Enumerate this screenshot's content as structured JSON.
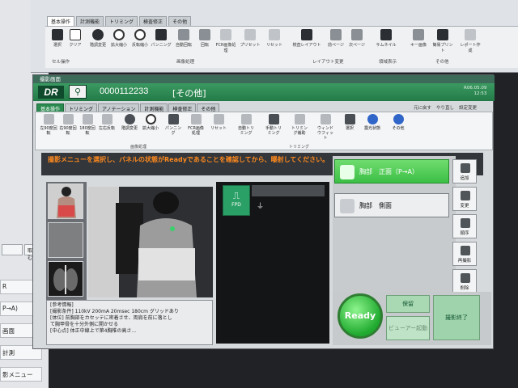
{
  "bg": {
    "tabs": [
      "基本操作",
      "計測機能",
      "トリミング",
      "検査修正",
      "その他"
    ],
    "tools": [
      "選択",
      "クリア",
      "階調変更",
      "拡大縮小",
      "反転縮小",
      "パンニング",
      "自動回転",
      "回転",
      "FCR画像処理",
      "プリセット",
      "リセット",
      "検査レイアウト",
      "前ページ",
      "次ページ",
      "サムネイル",
      "キー画像",
      "簡易プリント",
      "レポート作成"
    ],
    "groups": [
      "セル操作",
      "画像処理",
      "レイアウト変更",
      "領域表示",
      "その他"
    ],
    "left_items": [
      "R",
      "P→A)",
      "画面",
      "計測",
      "影メニュー"
    ],
    "left_buttons": [
      "",
      "取り込む"
    ]
  },
  "dialog": {
    "title": "撮影画面",
    "logo": "DR",
    "patient_id": "0000112233",
    "category": "[その他]",
    "date": "R06.05.09",
    "time": "12:53",
    "tabs": [
      "基本操作",
      "トリミング",
      "アノテーション",
      "計測機能",
      "検査修正",
      "その他"
    ],
    "top_links": [
      "元に戻す",
      "やり直し",
      "設定変更"
    ],
    "tools": [
      "左90度回転",
      "右90度回転",
      "180度回転",
      "左右反転",
      "階調変更",
      "拡大縮小",
      "パンニング",
      "FCR画像処理",
      "リセット",
      "自動トリミング",
      "手動トリミング",
      "トリミング補助",
      "ウィンドウフィット",
      "選択",
      "露光状態",
      "その他"
    ],
    "groups": [
      "画像処理",
      "トリミング"
    ],
    "message": "撮影メニューを選択し、パネルの状態がReadyであることを確認してから、曝射してください。",
    "info_lines": [
      "[参考情報]",
      "[撮影条件] 110kV 200mA 20msec 180cm グリッドあり",
      "[体位] 前胸部をカセッテに密着させ、両肩を前に落とし",
      "て胸甲骨を十分外側に開かせる",
      "[中心点] 体正中線上で第4胸椎の高さ..."
    ],
    "panel_label": "FPD",
    "protocols": [
      {
        "label": "胸部　正面（P→A）",
        "selected": true
      },
      {
        "label": "胸部　側面",
        "selected": false
      }
    ],
    "side_buttons": [
      "追加",
      "変更",
      "順序",
      "再撮影",
      "削除"
    ],
    "ready": "Ready",
    "hold": "保留",
    "end_exam": "撮影終了",
    "preview_label": "ビューアー起動",
    "colors": {
      "accent": "#2a8a4f",
      "warning": "#ff8a1f",
      "ready": "#1fa92e"
    }
  }
}
